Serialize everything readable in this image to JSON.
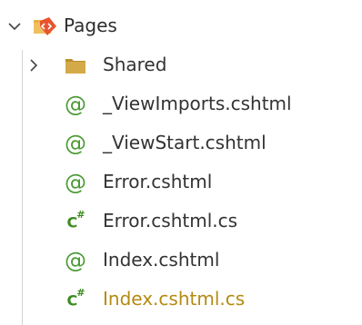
{
  "root": {
    "label": "Pages",
    "expanded": true,
    "icon": "pages-folder-icon"
  },
  "items": [
    {
      "label": "Shared",
      "type": "folder",
      "icon": "folder-icon",
      "collapsed": true
    },
    {
      "label": "_ViewImports.cshtml",
      "type": "razor",
      "icon": "razor-icon",
      "glyph": "@"
    },
    {
      "label": "_ViewStart.cshtml",
      "type": "razor",
      "icon": "razor-icon",
      "glyph": "@"
    },
    {
      "label": "Error.cshtml",
      "type": "razor",
      "icon": "razor-icon",
      "glyph": "@"
    },
    {
      "label": "Error.cshtml.cs",
      "type": "csharp",
      "icon": "csharp-icon",
      "glyph": "C#"
    },
    {
      "label": "Index.cshtml",
      "type": "razor",
      "icon": "razor-icon",
      "glyph": "@"
    },
    {
      "label": "Index.cshtml.cs",
      "type": "csharp",
      "icon": "csharp-icon",
      "glyph": "C#",
      "modified": true
    }
  ],
  "colors": {
    "razor": "#4a9a32",
    "csharp": "#3a8c1f",
    "folder": "#c9a13a",
    "modified": "#b58a12",
    "guide": "#d4d4d4"
  }
}
